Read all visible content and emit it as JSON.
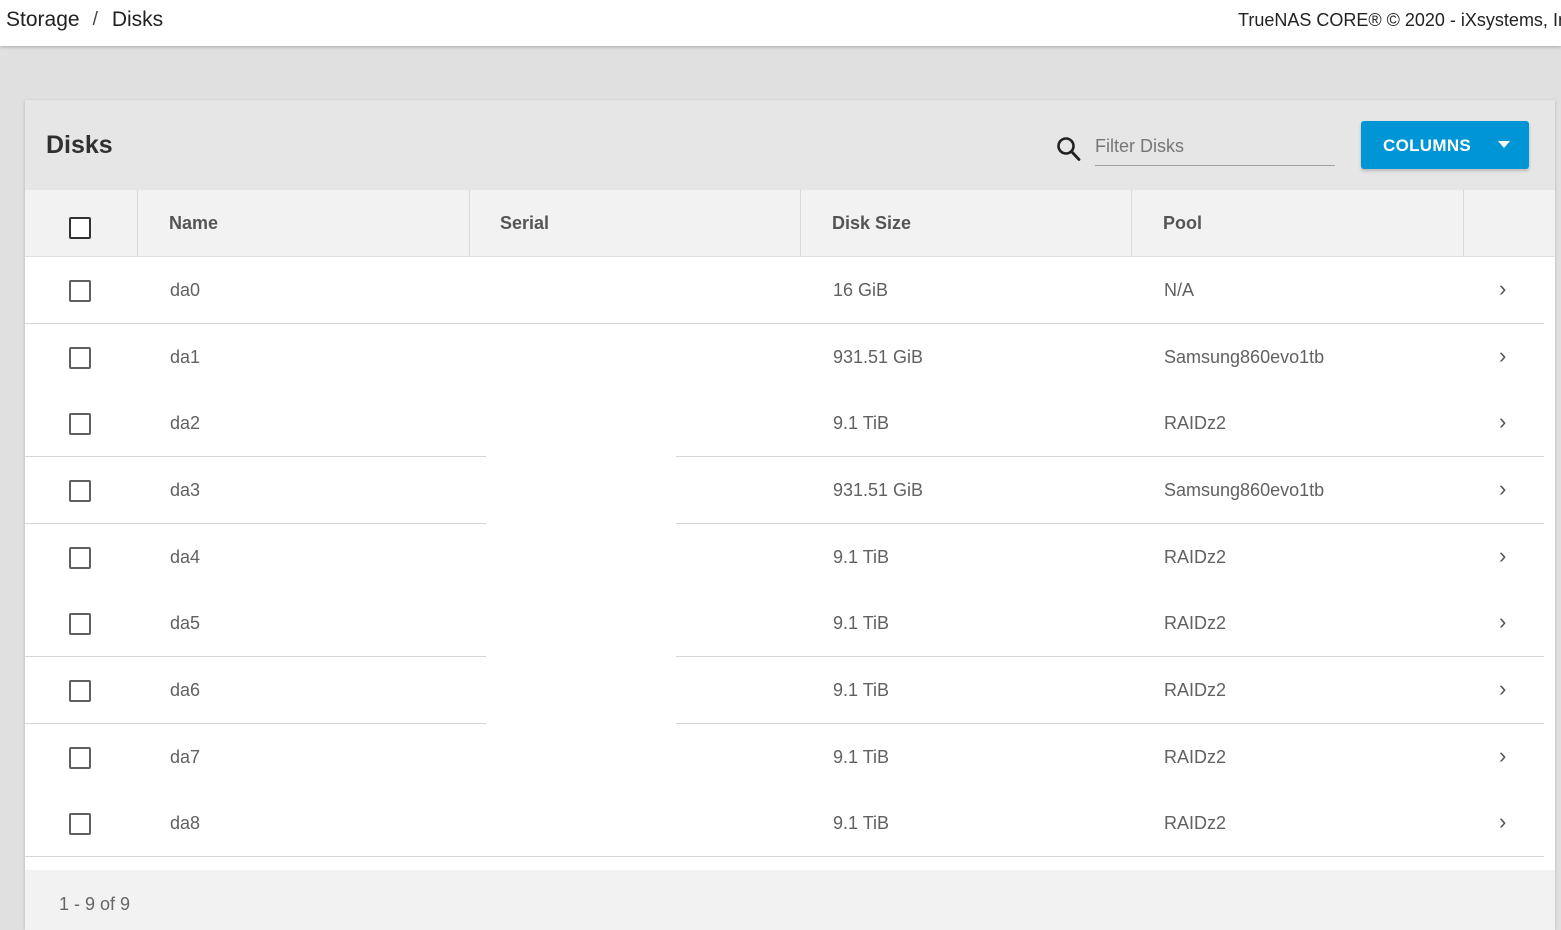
{
  "breadcrumb": {
    "parent": "Storage",
    "separator": "/",
    "current": "Disks"
  },
  "copyright": "TrueNAS CORE® © 2020 - iXsystems, In",
  "card": {
    "title": "Disks",
    "filter_placeholder": "Filter Disks",
    "columns_button": "COLUMNS"
  },
  "table": {
    "headers": {
      "name": "Name",
      "serial": "Serial",
      "disk_size": "Disk Size",
      "pool": "Pool"
    },
    "rows": [
      {
        "name": "da0",
        "serial": "",
        "disk_size": "16 GiB",
        "pool": "N/A"
      },
      {
        "name": "da1",
        "serial": "",
        "disk_size": "931.51 GiB",
        "pool": "Samsung860evo1tb"
      },
      {
        "name": "da2",
        "serial": "",
        "disk_size": "9.1 TiB",
        "pool": "RAIDz2"
      },
      {
        "name": "da3",
        "serial": "",
        "disk_size": "931.51 GiB",
        "pool": "Samsung860evo1tb"
      },
      {
        "name": "da4",
        "serial": "",
        "disk_size": "9.1 TiB",
        "pool": "RAIDz2"
      },
      {
        "name": "da5",
        "serial": "",
        "disk_size": "9.1 TiB",
        "pool": "RAIDz2"
      },
      {
        "name": "da6",
        "serial": "",
        "disk_size": "9.1 TiB",
        "pool": "RAIDz2"
      },
      {
        "name": "da7",
        "serial": "",
        "disk_size": "9.1 TiB",
        "pool": "RAIDz2"
      },
      {
        "name": "da8",
        "serial": "",
        "disk_size": "9.1 TiB",
        "pool": "RAIDz2"
      }
    ]
  },
  "pagination": {
    "range": "1 - 9 of 9"
  },
  "icons": {
    "search": "search-icon",
    "dropdown": "caret-down-icon",
    "row_expand": "chevron-right-icon"
  },
  "colors": {
    "accent": "#0095d5",
    "page_bg": "#e0e0e0",
    "header_bg": "#e6e6e6"
  }
}
